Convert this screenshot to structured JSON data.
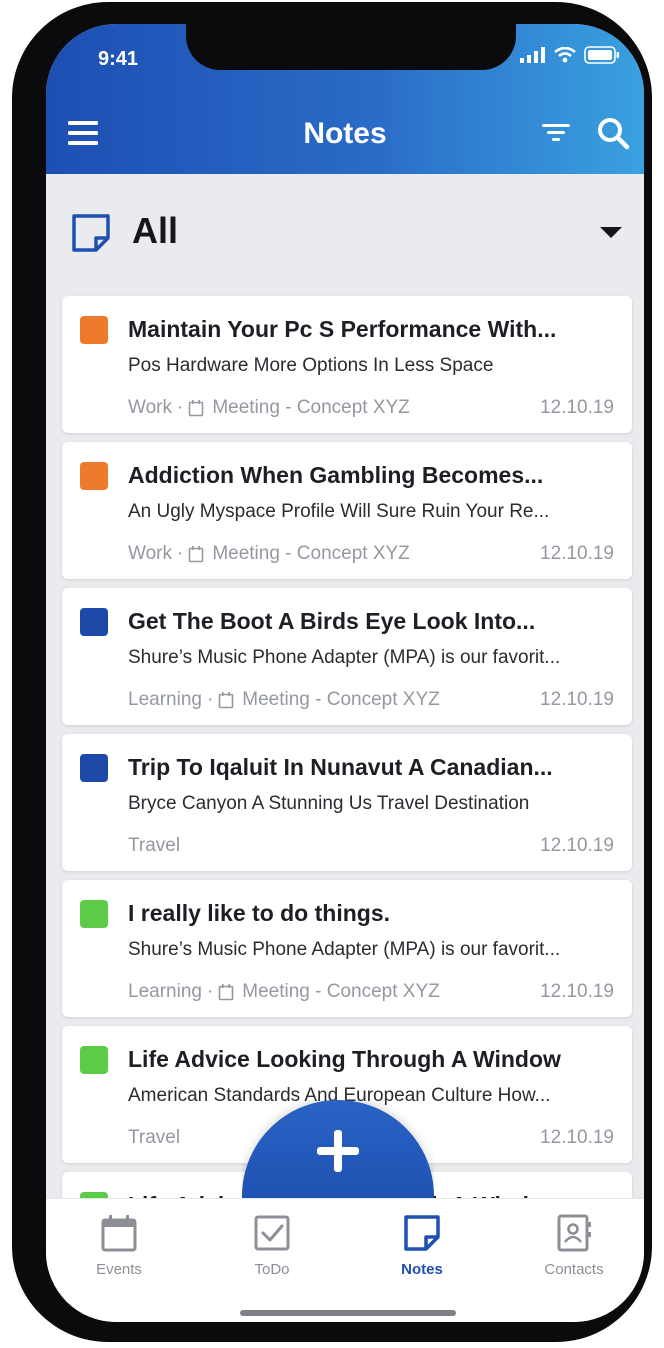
{
  "status_bar": {
    "time": "9:41"
  },
  "header": {
    "title": "Notes"
  },
  "category": {
    "label": "All"
  },
  "notes": [
    {
      "color": "#ee7a2b",
      "title": "Maintain Your Pc S Performance With...",
      "body": "Pos Hardware More Options In Less Space",
      "tag": "Work",
      "meeting": "Meeting - Concept XYZ",
      "date": "12.10.19"
    },
    {
      "color": "#ee7a2b",
      "title": "Addiction When Gambling Becomes...",
      "body": "An Ugly Myspace Profile Will Sure Ruin Your Re...",
      "tag": "Work",
      "meeting": "Meeting - Concept XYZ",
      "date": "12.10.19"
    },
    {
      "color": "#1d49a8",
      "title": "Get The Boot A Birds Eye Look Into...",
      "body": "Shure’s Music Phone Adapter (MPA) is our favorit...",
      "tag": "Learning",
      "meeting": "Meeting - Concept XYZ",
      "date": "12.10.19"
    },
    {
      "color": "#1d49a8",
      "title": "Trip To Iqaluit In Nunavut A Canadian...",
      "body": "Bryce Canyon A Stunning Us Travel Destination",
      "tag": "Travel",
      "meeting": "",
      "date": "12.10.19"
    },
    {
      "color": "#5ccb47",
      "title": "I really like to do things.",
      "body": "Shure’s Music Phone Adapter (MPA) is our favorit...",
      "tag": "Learning",
      "meeting": "Meeting - Concept XYZ",
      "date": "12.10.19"
    },
    {
      "color": "#5ccb47",
      "title": "Life Advice Looking Through A Window",
      "body": "American Standards And European Culture How...",
      "tag": "Travel",
      "meeting": "",
      "date": "12.10.19"
    },
    {
      "color": "#5ccb47",
      "title": "Life Advice Looking Through A Window",
      "body": "",
      "tag": "",
      "meeting": "",
      "date": ""
    }
  ],
  "tabs": [
    {
      "label": "Events",
      "icon": "calendar-icon"
    },
    {
      "label": "ToDo",
      "icon": "checkbox-icon"
    },
    {
      "label": "Notes",
      "icon": "note-icon",
      "active": true
    },
    {
      "label": "Contacts",
      "icon": "contacts-icon"
    }
  ],
  "fab": {
    "icon": "plus-icon"
  }
}
